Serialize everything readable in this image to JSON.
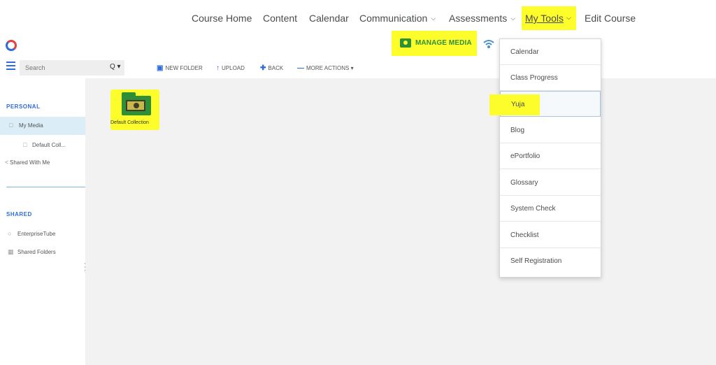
{
  "top_nav": {
    "items": [
      "Course Home",
      "Content",
      "Calendar",
      "Communication",
      "Assessments",
      "My Tools",
      "Edit Course"
    ]
  },
  "app_header": {
    "manage_media_label": "MANAGE MEDIA"
  },
  "toolbar": {
    "search_placeholder": "Search",
    "search_button": "Q",
    "new_folder": "NEW FOLDER",
    "upload": "UPLOAD",
    "back": "BACK",
    "more_actions": "MORE ACTIONS"
  },
  "sidebar": {
    "personal_heading": "PERSONAL",
    "my_media": "My Media",
    "default_coll": "Default Coll...",
    "shared_with_me": "Shared With Me",
    "shared_heading": "SHARED",
    "enterprise_tube": "EnterpriseTube",
    "shared_folders": "Shared Folders"
  },
  "main": {
    "folder_label": "Default Collection"
  },
  "dropdown": {
    "items": [
      "Calendar",
      "Class Progress",
      "Yuja",
      "Blog",
      "ePortfolio",
      "Glossary",
      "System Check",
      "Checklist",
      "Self Registration"
    ]
  },
  "colors": {
    "highlight": "#fdfd2c",
    "accent_blue": "#2d6ddb",
    "accent_green": "#2f8f37",
    "selected_bg": "#dbedf7"
  }
}
